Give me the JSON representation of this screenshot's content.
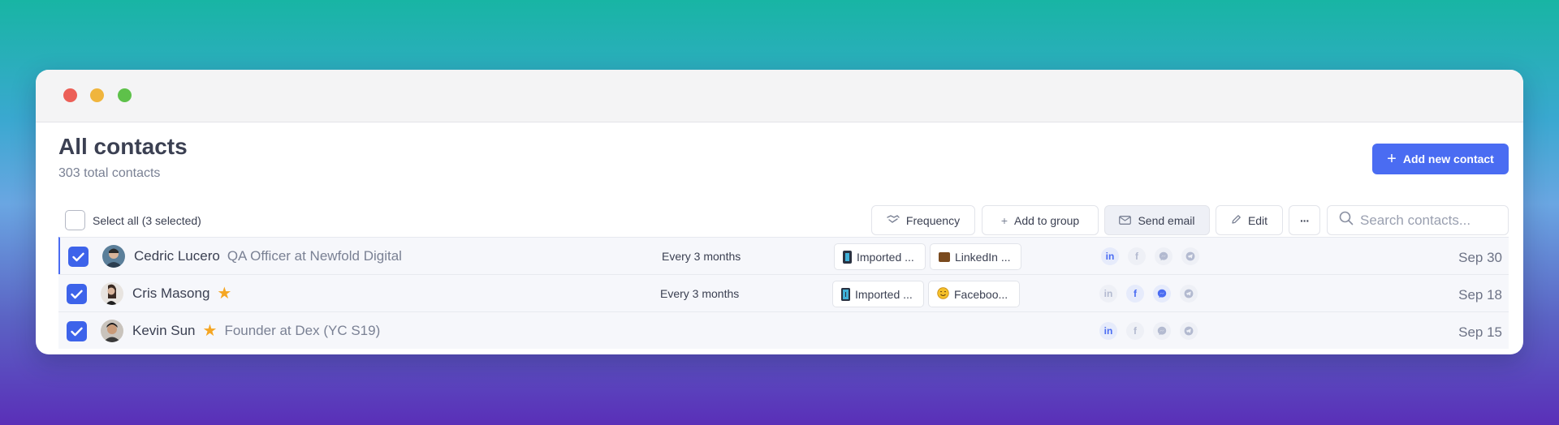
{
  "header": {
    "title": "All contacts",
    "subtitle": "303 total contacts",
    "add_button": "Add new contact"
  },
  "toolbar": {
    "select_all": "Select all (3 selected)",
    "frequency": "Frequency",
    "add_to_group": "Add to group",
    "send_email": "Send email",
    "edit": "Edit",
    "more": "···",
    "search_placeholder": "Search contacts..."
  },
  "contacts": [
    {
      "name": "Cedric Lucero",
      "role": "QA Officer at Newfold Digital",
      "starred": false,
      "frequency": "Every 3 months",
      "tags": [
        "Imported ...",
        "LinkedIn ..."
      ],
      "date": "Sep 30"
    },
    {
      "name": "Cris Masong",
      "role": "",
      "starred": true,
      "frequency": "Every 3 months",
      "tags": [
        "Imported ...",
        "Faceboo..."
      ],
      "date": "Sep 18"
    },
    {
      "name": "Kevin Sun",
      "role": "Founder at Dex (YC S19)",
      "starred": true,
      "frequency": "",
      "tags": [],
      "date": "Sep 15"
    }
  ],
  "colors": {
    "accent": "#4a6cf2",
    "star": "#f5a623"
  }
}
